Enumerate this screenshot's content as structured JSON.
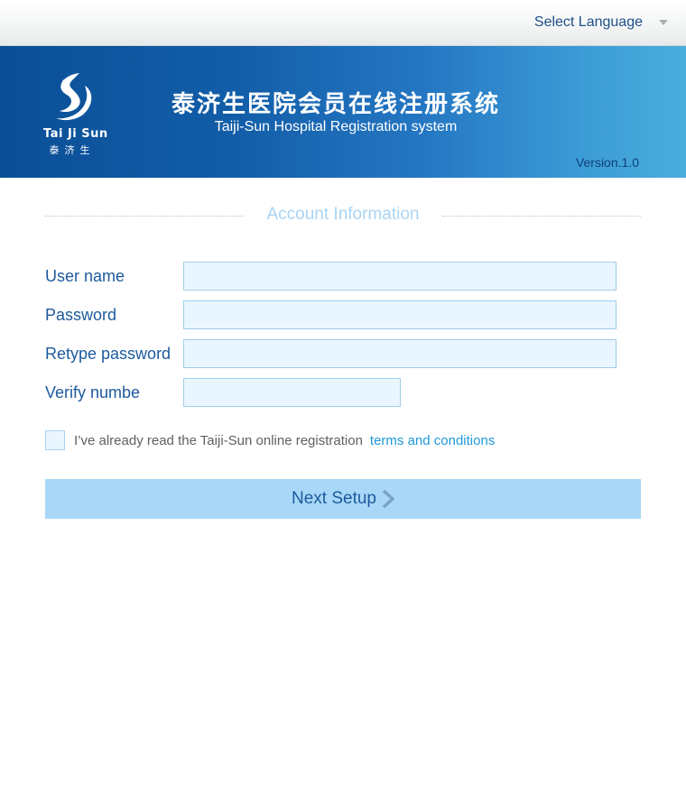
{
  "header": {
    "language_label": "Select Language",
    "language_caret_icon": "chevron-down-icon"
  },
  "banner": {
    "logo_text": "Tai Ji Sun",
    "logo_cn": "泰济生",
    "title_cn": "泰济生医院会员在线注册系统",
    "subtitle": "Taiji-Sun Hospital Registration system",
    "version": "Version.1.0"
  },
  "form": {
    "section_title": "Account Information",
    "fields": [
      {
        "label": "User name",
        "value": "",
        "placeholder": ""
      },
      {
        "label": "Password",
        "value": "",
        "placeholder": ""
      },
      {
        "label": "Retype password",
        "value": "",
        "placeholder": ""
      },
      {
        "label": "Verify numbe",
        "value": "",
        "placeholder": ""
      }
    ],
    "agree_text": "I’ve already read the Taiji-Sun online registration",
    "terms_link": "terms and conditions",
    "next_label": "Next Setup",
    "next_icon": "chevron-right-icon"
  },
  "colors": {
    "banner_dark": "#0a4f96",
    "banner_light": "#4aaddc",
    "label_blue": "#1d5a9d",
    "input_bg": "#eaf6ff",
    "button_bg": "#a9d7f7",
    "link_blue": "#1e9ad8"
  }
}
